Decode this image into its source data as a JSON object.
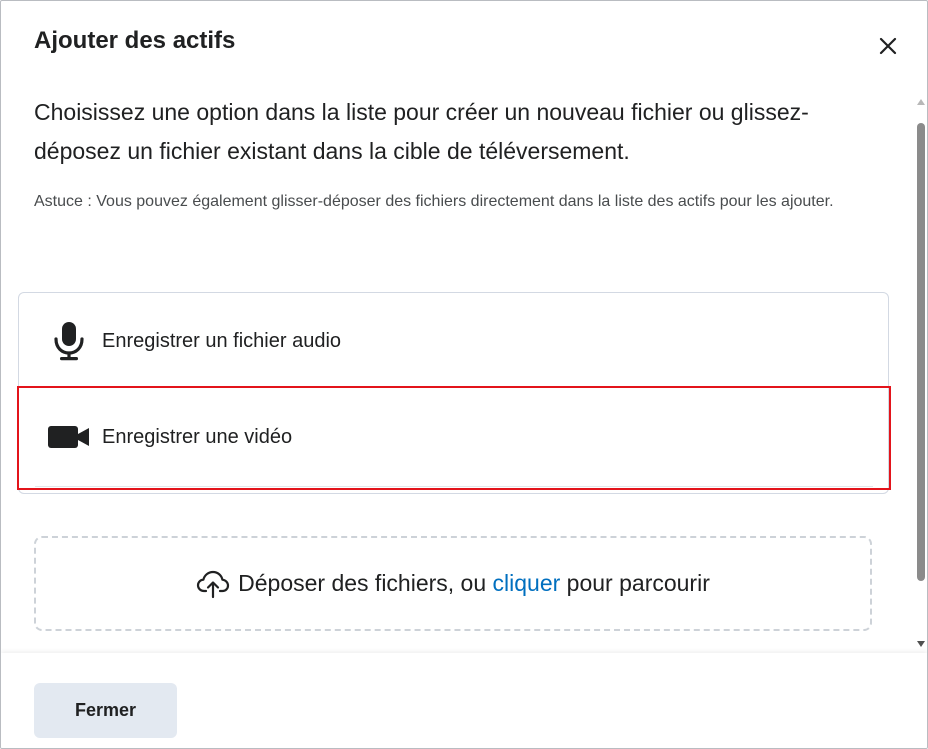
{
  "dialog": {
    "title": "Ajouter des actifs",
    "close_icon": "close-icon"
  },
  "intro": "Choisissez une option dans la liste pour créer un nouveau fichier ou glissez-déposez un fichier existant dans la cible de téléversement.",
  "tip": "Astuce : Vous pouvez également glisser-déposer des fichiers directement dans la liste des actifs pour les ajouter.",
  "options": [
    {
      "label": "Enregistrer un fichier audio",
      "icon": "microphone-icon"
    },
    {
      "label": "Enregistrer une vidéo",
      "icon": "video-camera-icon"
    }
  ],
  "dropzone": {
    "icon": "cloud-upload-icon",
    "text_before": "Déposer des fichiers, ou ",
    "link": "cliquer",
    "text_after": " pour parcourir"
  },
  "footer": {
    "close_label": "Fermer"
  },
  "colors": {
    "link": "#006fbf",
    "highlight": "#e3141b",
    "button_bg": "#e3e9f1"
  }
}
